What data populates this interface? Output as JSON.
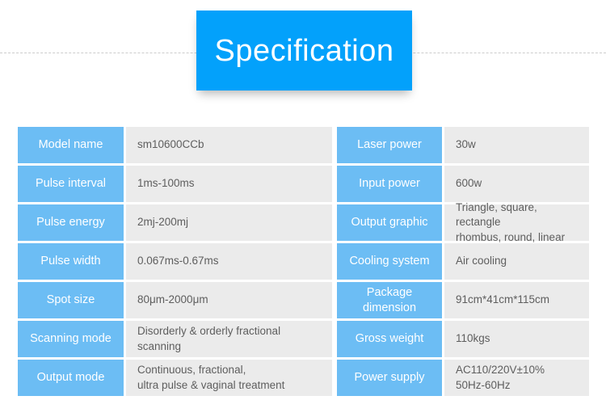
{
  "header": {
    "title": "Specification",
    "title_bg_color": "#03a1fb",
    "rule_color": "#cccccc"
  },
  "theme": {
    "label_bg_color": "#6cbdf4",
    "value_bg_color": "#ebebeb",
    "label_text_color": "#ffffff",
    "value_text_color": "#5e5e5e"
  },
  "spec": {
    "left_column": [
      {
        "label": "Model name",
        "value": "sm10600CCb"
      },
      {
        "label": "Pulse interval",
        "value": "1ms-100ms"
      },
      {
        "label": "Pulse energy",
        "value": "2mj-200mj"
      },
      {
        "label": "Pulse width",
        "value": "0.067ms-0.67ms"
      },
      {
        "label": "Spot size",
        "value": "80μm-2000μm"
      },
      {
        "label": "Scanning\nmode",
        "value": "Disorderly & orderly fractional\nscanning"
      },
      {
        "label": "Output mode",
        "value": "Continuous, fractional,\nultra pulse & vaginal treatment"
      }
    ],
    "right_column": [
      {
        "label": "Laser power",
        "value": "30w"
      },
      {
        "label": "Input power",
        "value": "600w"
      },
      {
        "label": "Output graphic",
        "value": "Triangle, square, rectangle\nrhombus, round, linear"
      },
      {
        "label": "Cooling system",
        "value": "Air cooling"
      },
      {
        "label": "Package\ndimension",
        "value": "91cm*41cm*115cm"
      },
      {
        "label": "Gross weight",
        "value": "110kgs"
      },
      {
        "label": "Power supply",
        "value": "AC110/220V±10%\n50Hz-60Hz"
      }
    ]
  }
}
